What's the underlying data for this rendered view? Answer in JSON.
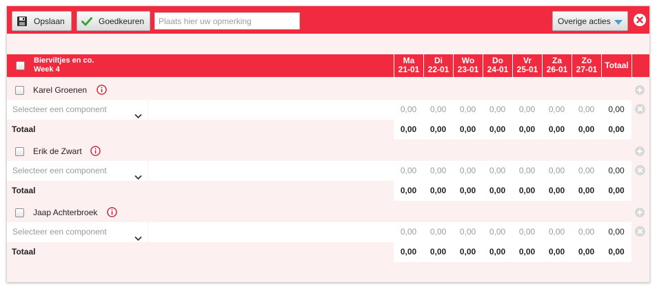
{
  "toolbar": {
    "save_label": "Opslaan",
    "approve_label": "Goedkeuren",
    "remark_placeholder": "Plaats hier uw opmerking",
    "other_actions_label": "Overige acties"
  },
  "table": {
    "header_title_line1": "Bierviltjes en co.",
    "header_title_line2": "Week 4",
    "days": [
      {
        "day": "Ma",
        "date": "21-01"
      },
      {
        "day": "Di",
        "date": "22-01"
      },
      {
        "day": "Wo",
        "date": "23-01"
      },
      {
        "day": "Do",
        "date": "24-01"
      },
      {
        "day": "Vr",
        "date": "25-01"
      },
      {
        "day": "Za",
        "date": "26-01"
      },
      {
        "day": "Zo",
        "date": "27-01"
      }
    ],
    "total_header": "Totaal",
    "component_placeholder": "Selecteer een component",
    "total_row_label": "Totaal",
    "employees": [
      {
        "name": "Karel Groenen",
        "hours": [
          "0,00",
          "0,00",
          "0,00",
          "0,00",
          "0,00",
          "0,00",
          "0,00"
        ],
        "hours_total": "0,00",
        "totals": [
          "0,00",
          "0,00",
          "0,00",
          "0,00",
          "0,00",
          "0,00",
          "0,00"
        ],
        "grand_total": "0,00"
      },
      {
        "name": "Erik de Zwart",
        "hours": [
          "0,00",
          "0,00",
          "0,00",
          "0,00",
          "0,00",
          "0,00",
          "0,00"
        ],
        "hours_total": "0,00",
        "totals": [
          "0,00",
          "0,00",
          "0,00",
          "0,00",
          "0,00",
          "0,00",
          "0,00"
        ],
        "grand_total": "0,00"
      },
      {
        "name": "Jaap Achterbroek",
        "hours": [
          "0,00",
          "0,00",
          "0,00",
          "0,00",
          "0,00",
          "0,00",
          "0,00"
        ],
        "hours_total": "0,00",
        "totals": [
          "0,00",
          "0,00",
          "0,00",
          "0,00",
          "0,00",
          "0,00",
          "0,00"
        ],
        "grand_total": "0,00"
      }
    ]
  },
  "colors": {
    "accent": "#f22a3f",
    "panel_background": "#fdf0f1"
  }
}
